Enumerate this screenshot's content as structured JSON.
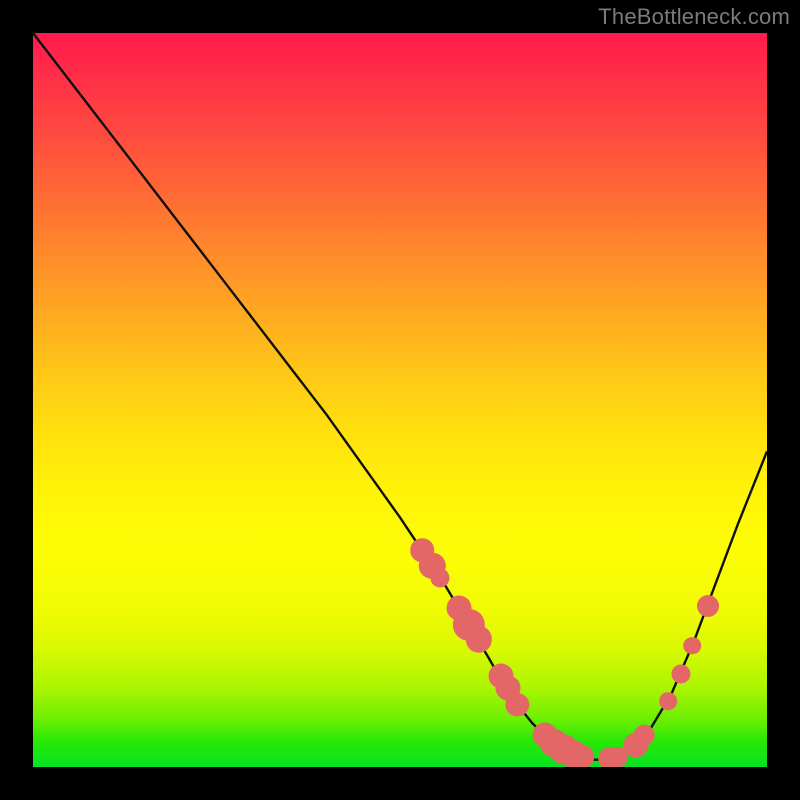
{
  "watermark": "TheBottleneck.com",
  "colors": {
    "dot": "#e46767",
    "curve": "#101010",
    "background_black": "#000000",
    "gradient_top": "#ff1a4d",
    "gradient_bottom": "#06e425"
  },
  "chart_data": {
    "type": "line",
    "title": "",
    "xlabel": "",
    "ylabel": "",
    "xlim": [
      0,
      100
    ],
    "ylim": [
      0,
      100
    ],
    "grid": false,
    "legend": false,
    "series": [
      {
        "name": "curve",
        "x": [
          0,
          5,
          10,
          15,
          20,
          25,
          30,
          35,
          40,
          45,
          50,
          53,
          56,
          59,
          62,
          64,
          66,
          68,
          70,
          72,
          74,
          76,
          78,
          81,
          84,
          87,
          90,
          93,
          96,
          100
        ],
        "y": [
          100,
          93.5,
          87,
          80.5,
          74,
          67.5,
          61,
          54.5,
          48,
          41,
          34,
          29.5,
          25,
          20,
          15,
          11.5,
          8.5,
          6,
          4,
          2.6,
          1.6,
          1.0,
          1.0,
          2.0,
          5.0,
          10.0,
          17.0,
          25.0,
          33.0,
          43.0
        ]
      }
    ],
    "dots": [
      {
        "x": 53.0,
        "y": 29.5,
        "r": 1.6
      },
      {
        "x": 54.4,
        "y": 27.4,
        "r": 1.8
      },
      {
        "x": 55.4,
        "y": 25.8,
        "r": 1.3
      },
      {
        "x": 58.0,
        "y": 21.7,
        "r": 1.7
      },
      {
        "x": 59.4,
        "y": 19.4,
        "r": 2.2
      },
      {
        "x": 60.7,
        "y": 17.4,
        "r": 1.8
      },
      {
        "x": 63.7,
        "y": 12.4,
        "r": 1.7
      },
      {
        "x": 64.7,
        "y": 10.8,
        "r": 1.7
      },
      {
        "x": 66.0,
        "y": 8.5,
        "r": 1.6
      },
      {
        "x": 69.8,
        "y": 4.3,
        "r": 1.7
      },
      {
        "x": 71.0,
        "y": 3.3,
        "r": 1.9
      },
      {
        "x": 72.3,
        "y": 2.4,
        "r": 2.0
      },
      {
        "x": 73.6,
        "y": 1.8,
        "r": 1.9
      },
      {
        "x": 74.8,
        "y": 1.4,
        "r": 1.6
      },
      {
        "x": 78.6,
        "y": 1.1,
        "r": 1.6
      },
      {
        "x": 79.6,
        "y": 1.3,
        "r": 1.4
      },
      {
        "x": 82.2,
        "y": 3.0,
        "r": 1.7
      },
      {
        "x": 83.3,
        "y": 4.3,
        "r": 1.4
      },
      {
        "x": 86.5,
        "y": 9.0,
        "r": 1.2
      },
      {
        "x": 88.3,
        "y": 12.7,
        "r": 1.3
      },
      {
        "x": 89.8,
        "y": 16.5,
        "r": 1.2
      },
      {
        "x": 92.0,
        "y": 22.0,
        "r": 1.5
      }
    ]
  }
}
